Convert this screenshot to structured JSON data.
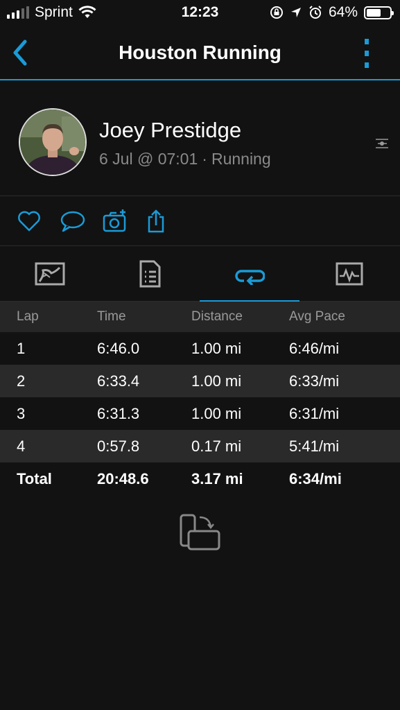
{
  "status_bar": {
    "carrier": "Sprint",
    "time": "12:23",
    "battery_percent": "64%",
    "battery_level": 0.64,
    "icons": [
      "signal-icon",
      "wifi-icon",
      "orientation-lock-icon",
      "location-icon",
      "alarm-icon",
      "battery-icon"
    ]
  },
  "nav": {
    "title": "Houston Running",
    "back_icon": "chevron-left-icon",
    "more_icon": "more-vertical-icon"
  },
  "profile": {
    "name": "Joey Prestidge",
    "date": "6 Jul @ 07:01",
    "separator": "·",
    "activity_type": "Running",
    "type_icon": "running-icon"
  },
  "actions": [
    {
      "name": "like-button",
      "icon": "heart-icon"
    },
    {
      "name": "comment-button",
      "icon": "comment-icon"
    },
    {
      "name": "add-photo-button",
      "icon": "camera-add-icon"
    },
    {
      "name": "share-button",
      "icon": "share-icon"
    }
  ],
  "tabs": [
    {
      "name": "tab-map",
      "icon": "map-icon",
      "active": false
    },
    {
      "name": "tab-stats",
      "icon": "document-list-icon",
      "active": false
    },
    {
      "name": "tab-laps",
      "icon": "laps-icon",
      "active": true
    },
    {
      "name": "tab-charts",
      "icon": "chart-icon",
      "active": false
    }
  ],
  "laps": {
    "headers": [
      "Lap",
      "Time",
      "Distance",
      "Avg Pace"
    ],
    "rows": [
      [
        "1",
        "6:46.0",
        "1.00 mi",
        "6:46/mi"
      ],
      [
        "2",
        "6:33.4",
        "1.00 mi",
        "6:33/mi"
      ],
      [
        "3",
        "6:31.3",
        "1.00 mi",
        "6:31/mi"
      ],
      [
        "4",
        "0:57.8",
        "0.17 mi",
        "5:41/mi"
      ]
    ],
    "total": [
      "Total",
      "20:48.6",
      "3.17 mi",
      "6:34/mi"
    ]
  },
  "rotate_icon": "rotate-device-icon",
  "colors": {
    "accent": "#1a9bd7",
    "background": "#121212",
    "row_alt": "#2a2a2a",
    "header_bg": "#262626",
    "muted_text": "#8a8a8a"
  }
}
